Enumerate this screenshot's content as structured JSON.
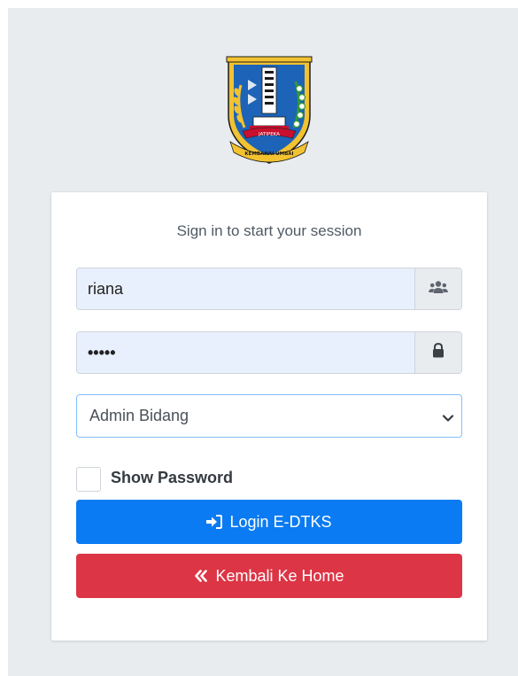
{
  "login": {
    "message": "Sign in to start your session",
    "username_value": "riana",
    "password_mask": "•••••",
    "role_selected": "Admin Bidang",
    "show_password_label": "Show Password",
    "login_button_label": "Login E-DTKS",
    "home_button_label": "Kembali Ke Home"
  },
  "logo": {
    "ribbon_text": "JATIPEKA",
    "motto_text": "KEMBANAI UMBAI"
  },
  "colors": {
    "primary": "#0a7bf2",
    "danger": "#dc3545",
    "page_background": "#e9ecef",
    "input_autofill": "#e8f0fe"
  },
  "icons": {
    "username_addon": "users-icon",
    "password_addon": "lock-icon",
    "select_indicator": "chevron-down-icon",
    "login_button": "sign-in-icon",
    "home_button": "angle-double-left-icon"
  }
}
